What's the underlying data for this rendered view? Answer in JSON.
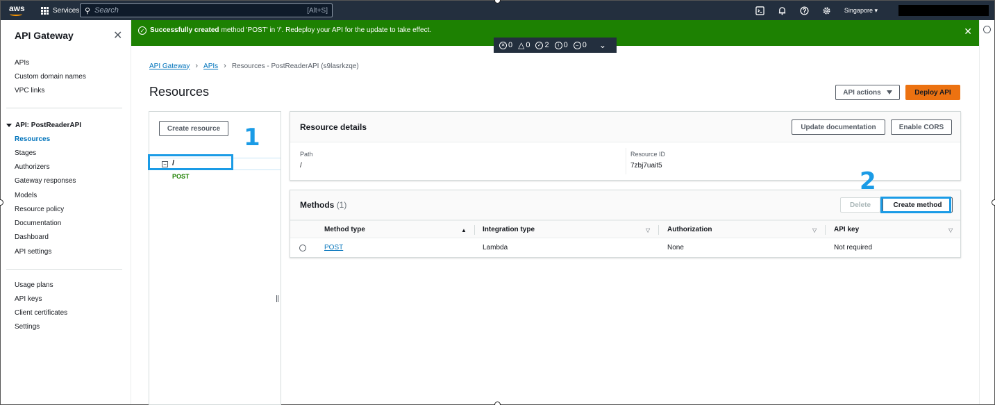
{
  "topnav": {
    "logo_text": "aws",
    "services_label": "Services",
    "search_placeholder": "Search",
    "search_shortcut": "[Alt+S]",
    "region": "Singapore",
    "icons": [
      "cloudshell-icon",
      "bell-icon",
      "help-icon",
      "gear-icon"
    ]
  },
  "sidebar": {
    "title": "API Gateway",
    "top_items": [
      "APIs",
      "Custom domain names",
      "VPC links"
    ],
    "api_section": "API: PostReaderAPI",
    "api_items": [
      {
        "label": "Resources",
        "active": true
      },
      {
        "label": "Stages",
        "active": false
      },
      {
        "label": "Authorizers",
        "active": false
      },
      {
        "label": "Gateway responses",
        "active": false
      },
      {
        "label": "Models",
        "active": false
      },
      {
        "label": "Resource policy",
        "active": false
      },
      {
        "label": "Documentation",
        "active": false
      },
      {
        "label": "Dashboard",
        "active": false
      },
      {
        "label": "API settings",
        "active": false
      }
    ],
    "bottom_items": [
      "Usage plans",
      "API keys",
      "Client certificates",
      "Settings"
    ]
  },
  "flash": {
    "bold": "Successfully created",
    "message": "method 'POST' in '/'. Redeploy your API for the update to take effect.",
    "color": "#1d8102"
  },
  "notifications": {
    "errors": "0",
    "warnings": "0",
    "success": "2",
    "info": "0",
    "in_progress": "0"
  },
  "breadcrumb": {
    "items": [
      "API Gateway",
      "APIs"
    ],
    "current": "Resources - PostReaderAPI (s9lasrkzqe)"
  },
  "page": {
    "title": "Resources",
    "api_actions_label": "API actions",
    "deploy_label": "Deploy API",
    "accent": "#ec7211"
  },
  "tree": {
    "create_resource_label": "Create resource",
    "root": "/",
    "method": "POST"
  },
  "resource_details": {
    "title": "Resource details",
    "update_doc_label": "Update documentation",
    "enable_cors_label": "Enable CORS",
    "path_label": "Path",
    "path_value": "/",
    "resource_id_label": "Resource ID",
    "resource_id_value": "7zbj7uait5"
  },
  "methods": {
    "title": "Methods",
    "count": "(1)",
    "delete_label": "Delete",
    "create_label": "Create method",
    "columns": [
      "Method type",
      "Integration type",
      "Authorization",
      "API key"
    ],
    "rows": [
      {
        "method": "POST",
        "integration": "Lambda",
        "authorization": "None",
        "api_key": "Not required"
      }
    ]
  },
  "annotations": {
    "step1": "1",
    "step2": "2",
    "color": "#1a9be6"
  }
}
